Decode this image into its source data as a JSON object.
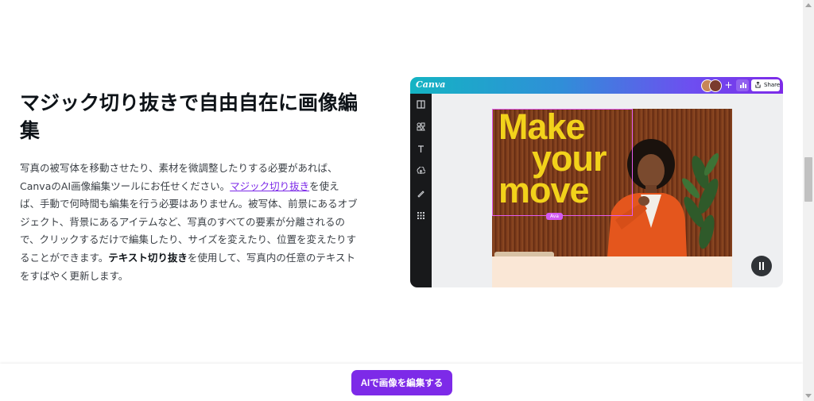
{
  "section": {
    "heading": "マジック切り抜きで自由自在に画像編集",
    "body_part1": "写真の被写体を移動させたり、素材を微調整したりする必要があれば、CanvaのAI画像編集ツールにお任せください。",
    "link_text": "マジック切り抜き",
    "body_part2": "を使えば、手動で何時間も編集を行う必要はありません。被写体、前景にあるオブジェクト、背景にあるアイテムなど、写真のすべての要素が分離されるので、クリックするだけで編集したり、サイズを変えたり、位置を変えたりすることができます。",
    "bold_text": "テキスト切り抜き",
    "body_part3": "を使用して、写真内の任意のテキストをすばやく更新します。"
  },
  "editor": {
    "logo": "Canva",
    "share_label": "Share",
    "plus_label": "+",
    "canvas_text": [
      "Make",
      "your",
      "move"
    ],
    "cursor_name": "Ava",
    "colors": {
      "header_start": "#14b4c3",
      "header_end": "#7d2ae8",
      "canvas_text": "#f2d21b",
      "selection": "#e35bf0"
    },
    "rail_icons": [
      "layout-icon",
      "elements-icon",
      "text-icon",
      "upload-icon",
      "draw-icon",
      "apps-icon"
    ]
  },
  "cta": {
    "button_label": "AIで画像を編集する",
    "color": "#7d2ae8"
  }
}
